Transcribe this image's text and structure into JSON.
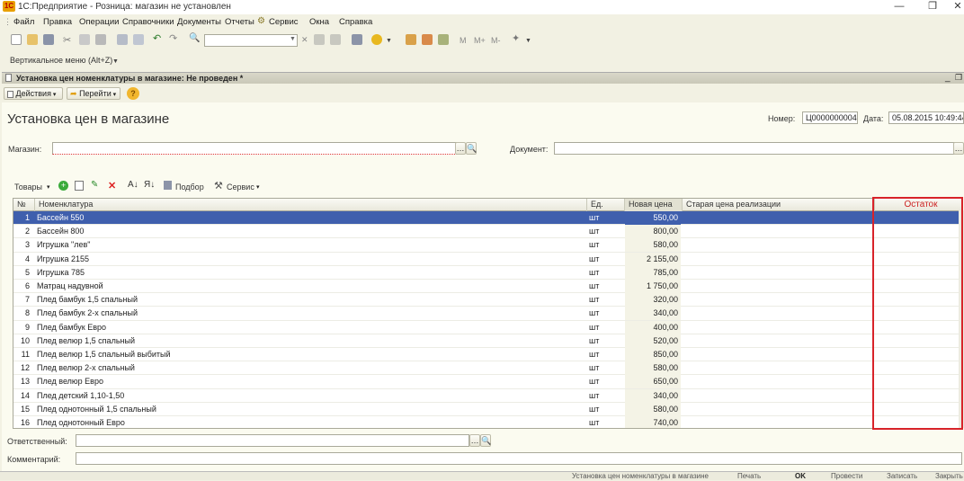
{
  "window": {
    "title": "1С:Предприятие - Розница: магазин не установлен",
    "logo_text": "1С"
  },
  "menu": [
    "Файл",
    "Правка",
    "Операции",
    "Справочники",
    "Документы",
    "Отчеты",
    "Сервис",
    "Окна",
    "Справка"
  ],
  "toolbar": {
    "m_label": "M",
    "mplus_label": "M+",
    "mminus_label": "M-"
  },
  "vertical_menu": "Вертикальное меню (Alt+Z)",
  "doc_header": "Установка цен номенклатуры в магазине: Не проведен *",
  "doc_toolbar": {
    "actions": "Действия",
    "goto": "Перейти",
    "help": "?"
  },
  "form": {
    "title": "Установка цен в магазине",
    "number_label": "Номер:",
    "number_value": "Ц0000000004",
    "date_label": "Дата:",
    "date_value": "05.08.2015 10:49:44",
    "store_label": "Магазин:",
    "store_value": "",
    "document_label": "Документ:",
    "document_value": "",
    "responsible_label": "Ответственный:",
    "responsible_value": "",
    "comment_label": "Комментарий:",
    "comment_value": ""
  },
  "table_toolbar": {
    "goods": "Товары",
    "selection": "Подбор",
    "service": "Сервис"
  },
  "table": {
    "columns": [
      "№",
      "Номенклатура",
      "Ед.",
      "Новая цена",
      "Старая цена реализации",
      "Остаток"
    ],
    "rows": [
      {
        "n": "1",
        "name": "Бассейн 550",
        "unit": "шт",
        "price": "550,00"
      },
      {
        "n": "2",
        "name": "Бассейн 800",
        "unit": "шт",
        "price": "800,00"
      },
      {
        "n": "3",
        "name": "Игрушка \"лев\"",
        "unit": "шт",
        "price": "580,00"
      },
      {
        "n": "4",
        "name": "Игрушка 2155",
        "unit": "шт",
        "price": "2 155,00"
      },
      {
        "n": "5",
        "name": "Игрушка 785",
        "unit": "шт",
        "price": "785,00"
      },
      {
        "n": "6",
        "name": "Матрац надувной",
        "unit": "шт",
        "price": "1 750,00"
      },
      {
        "n": "7",
        "name": "Плед бамбук 1,5 спальный",
        "unit": "шт",
        "price": "320,00"
      },
      {
        "n": "8",
        "name": "Плед бамбук 2-х спальный",
        "unit": "шт",
        "price": "340,00"
      },
      {
        "n": "9",
        "name": "Плед бамбук Евро",
        "unit": "шт",
        "price": "400,00"
      },
      {
        "n": "10",
        "name": "Плед велюр 1,5 спальный",
        "unit": "шт",
        "price": "520,00"
      },
      {
        "n": "11",
        "name": "Плед велюр 1,5 спальный выбитый",
        "unit": "шт",
        "price": "850,00"
      },
      {
        "n": "12",
        "name": "Плед велюр 2-х  спальный",
        "unit": "шт",
        "price": "580,00"
      },
      {
        "n": "13",
        "name": "Плед велюр Евро",
        "unit": "шт",
        "price": "650,00"
      },
      {
        "n": "14",
        "name": "Плед детский 1,10-1,50",
        "unit": "шт",
        "price": "340,00"
      },
      {
        "n": "15",
        "name": "Плед однотонный 1,5 спальный",
        "unit": "шт",
        "price": "580,00"
      },
      {
        "n": "16",
        "name": "Плед однотонный Евро",
        "unit": "шт",
        "price": "740,00"
      }
    ]
  },
  "status_bar": {
    "doc_name": "Установка цен номенклатуры в магазине",
    "print": "Печать",
    "ok": "OK",
    "post": "Провести",
    "save": "Записать",
    "close": "Закрыть"
  },
  "colors": {
    "selected_row": "#3f5fad",
    "highlight_box": "#d8232a",
    "background": "#f2f1e3"
  }
}
